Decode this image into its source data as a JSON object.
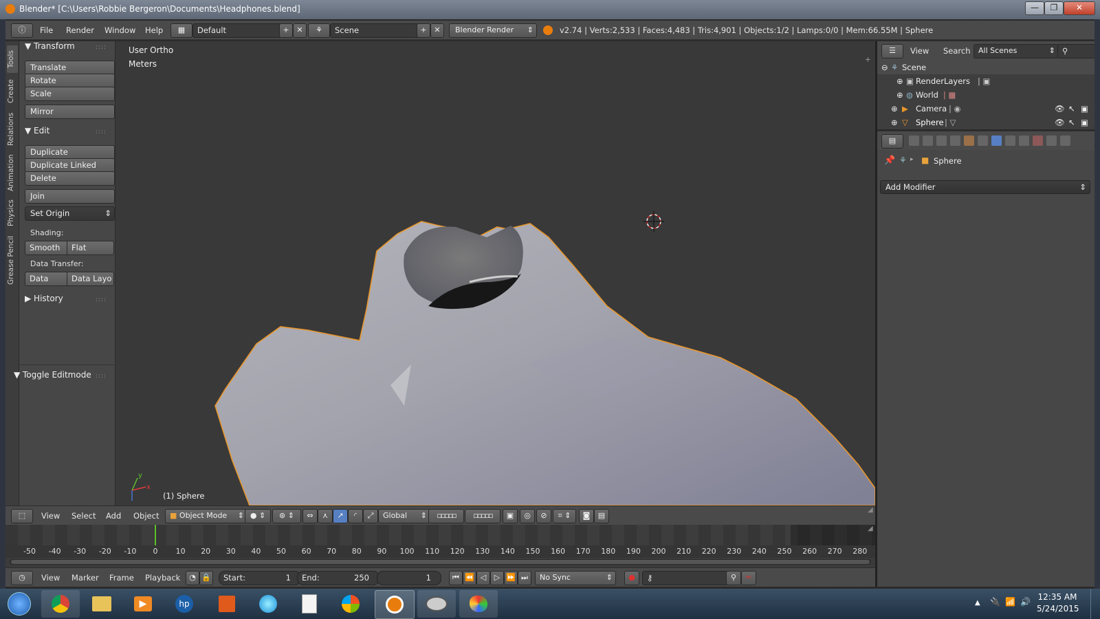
{
  "window": {
    "title": "Blender* [C:\\Users\\Robbie Bergeron\\Documents\\Headphones.blend]",
    "minimize": "—",
    "maximize": "❐",
    "close": "✕"
  },
  "info_header": {
    "menus": [
      "File",
      "Render",
      "Window",
      "Help"
    ],
    "layout": "Default",
    "scene": "Scene",
    "engine": "Blender Render",
    "stats": "v2.74 | Verts:2,533 | Faces:4,483 | Tris:4,901 | Objects:1/2 | Lamps:0/0 | Mem:66.55M | Sphere"
  },
  "tool_tabs": [
    "Tools",
    "Create",
    "Relations",
    "Animation",
    "Physics",
    "Grease Pencil"
  ],
  "tool_shelf": {
    "transform_title": "Transform",
    "translate": "Translate",
    "rotate": "Rotate",
    "scale": "Scale",
    "mirror": "Mirror",
    "edit_title": "Edit",
    "duplicate": "Duplicate",
    "duplicate_linked": "Duplicate Linked",
    "delete": "Delete",
    "join": "Join",
    "set_origin": "Set Origin",
    "shading_label": "Shading:",
    "smooth": "Smooth",
    "flat": "Flat",
    "data_transfer_label": "Data Transfer:",
    "data": "Data",
    "data_layo": "Data Layo",
    "history_title": "History",
    "toggle_editmode_title": "Toggle Editmode"
  },
  "viewport": {
    "view_name": "User Ortho",
    "units": "Meters",
    "active_object": "(1) Sphere"
  },
  "viewport_header": {
    "menus": [
      "View",
      "Select",
      "Add",
      "Object"
    ],
    "mode": "Object Mode",
    "orientation": "Global"
  },
  "timeline": {
    "ticks": [
      "-50",
      "-40",
      "-30",
      "-20",
      "-10",
      "0",
      "10",
      "20",
      "30",
      "40",
      "50",
      "60",
      "70",
      "80",
      "90",
      "100",
      "110",
      "120",
      "130",
      "140",
      "150",
      "160",
      "170",
      "180",
      "190",
      "200",
      "210",
      "220",
      "230",
      "240",
      "250",
      "260",
      "270",
      "280"
    ],
    "current_frame": 0,
    "menus": [
      "View",
      "Marker",
      "Frame",
      "Playback"
    ],
    "start_label": "Start:",
    "start_value": "1",
    "end_label": "End:",
    "end_value": "250",
    "frame_value": "1",
    "sync": "No Sync"
  },
  "outliner": {
    "menus": [
      "View",
      "Search"
    ],
    "filter": "All Scenes",
    "items": [
      "Scene",
      "RenderLayers",
      "World",
      "Camera",
      "Sphere"
    ]
  },
  "properties": {
    "context_object": "Sphere",
    "add_modifier": "Add Modifier"
  },
  "taskbar": {
    "time": "12:35 AM",
    "date": "5/24/2015"
  },
  "colors": {
    "selection_outline": "#e8962c",
    "accent_blue": "#5680c2",
    "current_frame_line": "#5fc22e"
  }
}
